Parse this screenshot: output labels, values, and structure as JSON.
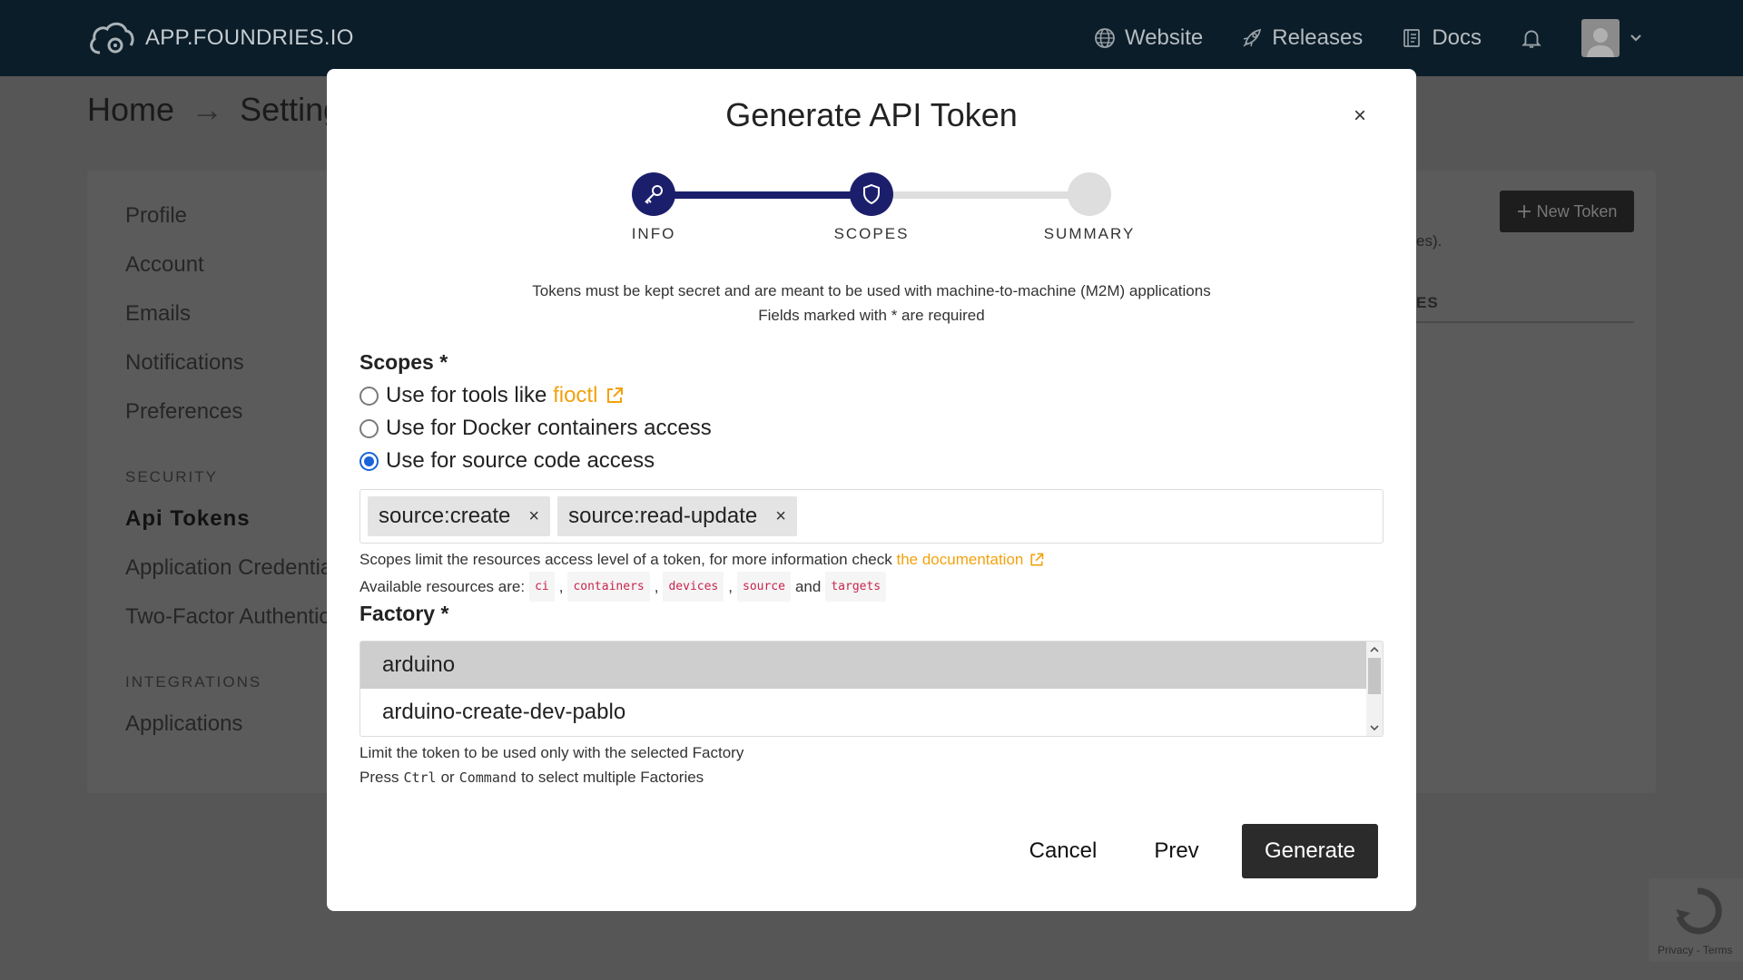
{
  "topbar": {
    "brand": "APP.FOUNDRIES.IO",
    "nav": [
      {
        "label": "Website",
        "icon": "globe-icon"
      },
      {
        "label": "Releases",
        "icon": "rocket-icon"
      },
      {
        "label": "Docs",
        "icon": "book-icon"
      }
    ]
  },
  "breadcrumb": {
    "home": "Home",
    "arrow": "→",
    "current": "Setting"
  },
  "sidebar": {
    "items": [
      "Profile",
      "Account",
      "Emails",
      "Notifications",
      "Preferences"
    ],
    "security_heading": "SECURITY",
    "security_items": [
      "Api Tokens",
      "Application Credentia",
      "Two-Factor Authentic"
    ],
    "integrations_heading": "INTEGRATIONS",
    "integrations_items": [
      "Applications"
    ]
  },
  "background": {
    "new_token_label": "New Token",
    "fragment1": "es).",
    "fragment2": "ES",
    "recaptcha": "Privacy - Terms"
  },
  "modal": {
    "title": "Generate API Token",
    "close": "×",
    "steps": [
      "INFO",
      "SCOPES",
      "SUMMARY"
    ],
    "intro_line1": "Tokens must be kept secret and are meant to be used with machine-to-machine (M2M) applications",
    "intro_line2": "Fields marked with * are required",
    "scopes_label": "Scopes *",
    "radio_options": [
      {
        "prefix": "Use for tools like ",
        "link": "fioctl",
        "checked": false
      },
      {
        "prefix": "Use for Docker containers access",
        "link": "",
        "checked": false
      },
      {
        "prefix": "Use for source code access",
        "link": "",
        "checked": true
      }
    ],
    "tags": [
      "source:create",
      "source:read-update"
    ],
    "tag_remove": "×",
    "scopes_help_prefix": "Scopes limit the resources access level of a token, for more information check ",
    "scopes_help_link": "the documentation",
    "resources_prefix": "Available resources are:",
    "resources": [
      "ci",
      "containers",
      "devices",
      "source",
      "targets"
    ],
    "resources_sep": ",",
    "resources_and": "and",
    "factory_label": "Factory *",
    "factories": [
      "arduino",
      "arduino-create-dev-pablo"
    ],
    "selected_factory": "arduino",
    "factory_help1": "Limit the token to be used only with the selected Factory",
    "factory_help2_a": "Press",
    "factory_help2_ctrl": "Ctrl",
    "factory_help2_or": "or",
    "factory_help2_cmd": "Command",
    "factory_help2_b": "to select multiple Factories",
    "buttons": {
      "cancel": "Cancel",
      "prev": "Prev",
      "generate": "Generate"
    }
  },
  "colors": {
    "accent": "#1b1f6b",
    "link": "#f2a20f",
    "radio": "#1a63d8",
    "code": "#c7254e"
  }
}
